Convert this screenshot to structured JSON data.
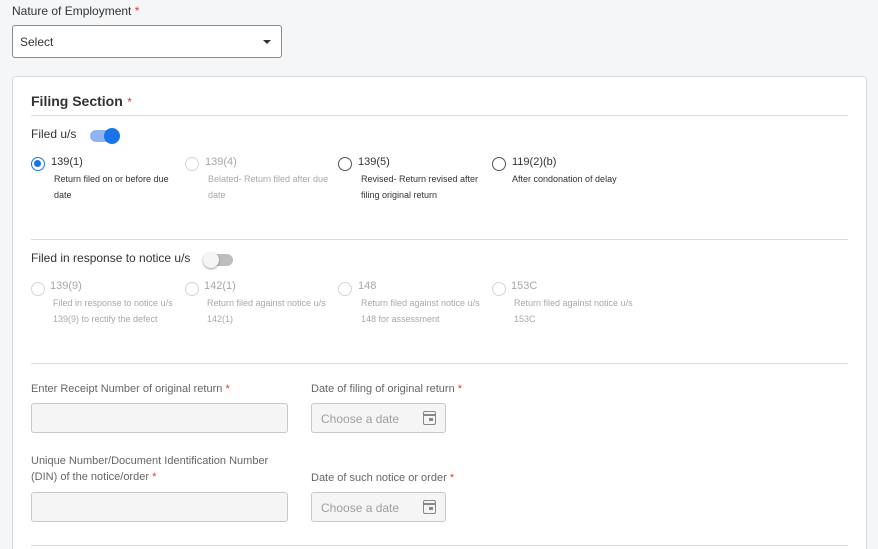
{
  "employment": {
    "label": "Nature of Employment",
    "required_mark": "*",
    "select_value": "Select"
  },
  "filing": {
    "title": "Filing Section",
    "required_mark": "*",
    "filed_us": {
      "label": "Filed u/s",
      "toggle_on": true,
      "options": [
        {
          "title": "139(1)",
          "desc1": "Return filed on or before due",
          "desc2": "date",
          "checked": true,
          "disabled": false
        },
        {
          "title": "139(4)",
          "desc1": "Belated- Return filed after due",
          "desc2": "date",
          "checked": false,
          "disabled": true
        },
        {
          "title": "139(5)",
          "desc1": "Revised- Return revised after",
          "desc2": "filing original return",
          "checked": false,
          "disabled": false
        },
        {
          "title": "119(2)(b)",
          "desc1": "After condonation of delay",
          "desc2": "",
          "checked": false,
          "disabled": false
        }
      ]
    },
    "notice": {
      "label": "Filed in response to notice u/s",
      "toggle_on": false,
      "options": [
        {
          "title": "139(9)",
          "desc1": "Filed in response to notice u/s",
          "desc2": "139(9) to rectify the defect"
        },
        {
          "title": "142(1)",
          "desc1": "Return filed against notice u/s",
          "desc2": "142(1)"
        },
        {
          "title": "148",
          "desc1": "Return filed against notice u/s",
          "desc2": "148 for assessment"
        },
        {
          "title": "153C",
          "desc1": "Return filed against notice u/s",
          "desc2": "153C"
        }
      ]
    },
    "fields": {
      "receipt_label": "Enter Receipt Number of original return",
      "date_filing_label": "Date of filing of original return",
      "din_label_line1": "Unique Number/Document Identification Number",
      "din_label_line2": "(DIN) of the notice/order",
      "date_notice_label": "Date of such notice or order",
      "date_placeholder": "Choose a date",
      "required_mark": "*"
    }
  },
  "colors": {
    "accent": "#1a73e8",
    "required": "#e53935"
  }
}
